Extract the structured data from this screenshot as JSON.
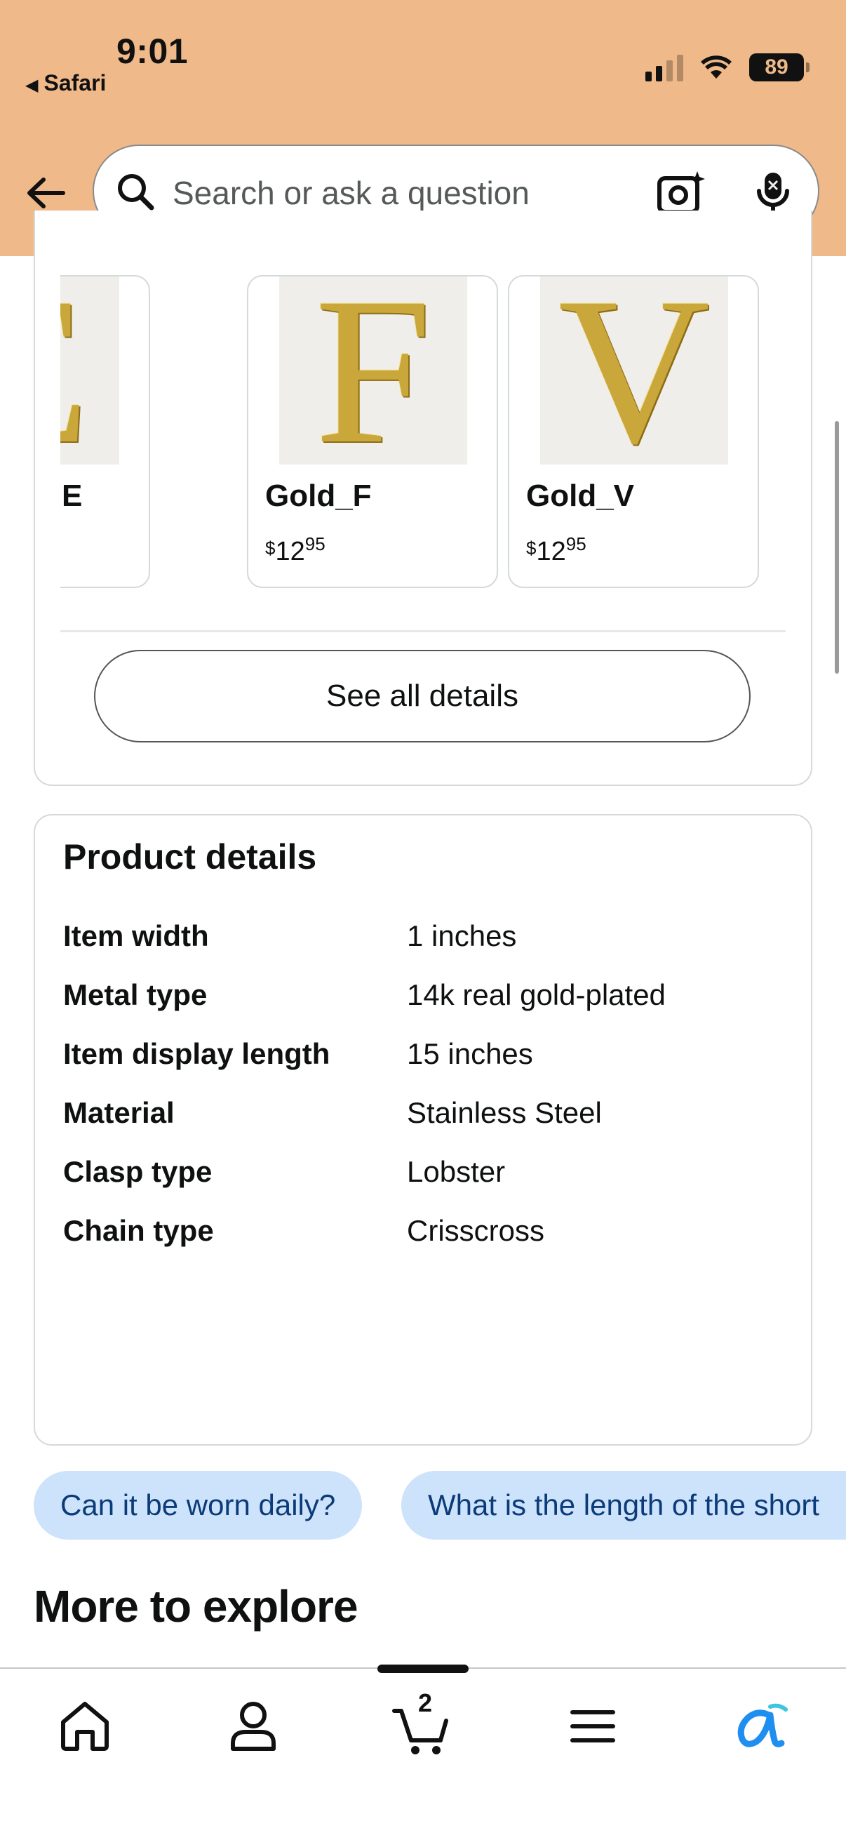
{
  "status_bar": {
    "time": "9:01",
    "back_app": "Safari",
    "battery": "89"
  },
  "search": {
    "placeholder": "Search or ask a question"
  },
  "variations": [
    {
      "name": "E",
      "letter": "E",
      "price_symbol": "$",
      "price_whole": "",
      "price_cents": ""
    },
    {
      "name": "Gold_F",
      "letter": "F",
      "price_symbol": "$",
      "price_whole": "12",
      "price_cents": "95"
    },
    {
      "name": "Gold_V",
      "letter": "V",
      "price_symbol": "$",
      "price_whole": "12",
      "price_cents": "95"
    }
  ],
  "see_all_label": "See all details",
  "product_details": {
    "title": "Product details",
    "rows": [
      {
        "label": "Item width",
        "value": "1 inches"
      },
      {
        "label": "Metal type",
        "value": "14k real gold-plated"
      },
      {
        "label": "Item display length",
        "value": "15 inches"
      },
      {
        "label": "Material",
        "value": "Stainless Steel"
      },
      {
        "label": "Clasp type",
        "value": "Lobster"
      },
      {
        "label": "Chain type",
        "value": "Crisscross"
      }
    ]
  },
  "question_chips": [
    "Can it be worn daily?",
    "What is the length of the short"
  ],
  "more_to_explore": "More to explore",
  "bottom_nav": {
    "items": [
      "home-icon",
      "account-icon",
      "cart-icon",
      "menu-icon",
      "rufus-icon"
    ],
    "cart_count": "2"
  },
  "colors": {
    "header_bg": "#efb989",
    "chip_bg": "#cde2fb",
    "chip_text": "#0b3b78",
    "ai_icon": "#1e8ef0"
  }
}
